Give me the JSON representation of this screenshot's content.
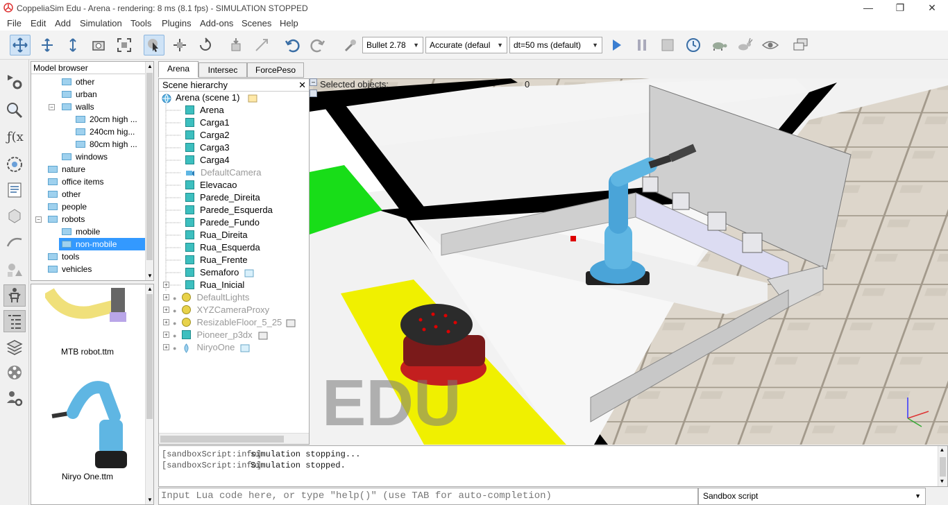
{
  "window": {
    "title": "CoppeliaSim Edu - Arena - rendering: 8 ms (8.1 fps) - SIMULATION STOPPED"
  },
  "menu": [
    "File",
    "Edit",
    "Add",
    "Simulation",
    "Tools",
    "Plugins",
    "Add-ons",
    "Scenes",
    "Help"
  ],
  "toolbar": {
    "engine": "Bullet 2.78",
    "accuracy": "Accurate (defaul",
    "timestep": "dt=50 ms (default)"
  },
  "model_browser": {
    "title": "Model browser",
    "items": [
      {
        "label": "other",
        "level": 2
      },
      {
        "label": "urban",
        "level": 2
      },
      {
        "label": "walls",
        "level": 2,
        "expanded": true
      },
      {
        "label": "20cm high ...",
        "level": 3
      },
      {
        "label": "240cm hig...",
        "level": 3
      },
      {
        "label": "80cm high ...",
        "level": 3
      },
      {
        "label": "windows",
        "level": 2
      },
      {
        "label": "nature",
        "level": 1
      },
      {
        "label": "office items",
        "level": 1
      },
      {
        "label": "other",
        "level": 1
      },
      {
        "label": "people",
        "level": 1
      },
      {
        "label": "robots",
        "level": 1,
        "expanded": true
      },
      {
        "label": "mobile",
        "level": 2
      },
      {
        "label": "non-mobile",
        "level": 2,
        "selected": true
      },
      {
        "label": "tools",
        "level": 1
      },
      {
        "label": "vehicles",
        "level": 1
      }
    ],
    "thumbnails": [
      "MTB robot.ttm",
      "Niryo One.ttm"
    ]
  },
  "tabs": [
    "Arena",
    "Intersec",
    "ForcePeso"
  ],
  "hierarchy": {
    "title": "Scene hierarchy",
    "root": "Arena (scene 1)",
    "items": [
      {
        "label": "Arena"
      },
      {
        "label": "Carga1"
      },
      {
        "label": "Carga2"
      },
      {
        "label": "Carga3"
      },
      {
        "label": "Carga4"
      },
      {
        "label": "DefaultCamera",
        "dim": true
      },
      {
        "label": "Elevacao"
      },
      {
        "label": "Parede_Direita"
      },
      {
        "label": "Parede_Esquerda"
      },
      {
        "label": "Parede_Fundo"
      },
      {
        "label": "Rua_Direita"
      },
      {
        "label": "Rua_Esquerda"
      },
      {
        "label": "Rua_Frente"
      },
      {
        "label": "Semaforo"
      },
      {
        "label": "Rua_Inicial"
      },
      {
        "label": "DefaultLights",
        "dim": true
      },
      {
        "label": "XYZCameraProxy",
        "dim": true
      },
      {
        "label": "ResizableFloor_5_25",
        "dim": true
      },
      {
        "label": "Pioneer_p3dx",
        "dim": true
      },
      {
        "label": "NiryoOne",
        "dim": true
      }
    ]
  },
  "viewport": {
    "selected_label": "Selected objects:",
    "selected_count": "0",
    "watermark": "EDU"
  },
  "console": {
    "lines": [
      {
        "src": "[sandboxScript:info]",
        "msg": "simulation stopping..."
      },
      {
        "src": "[sandboxScript:info]",
        "msg": "Simulation stopped."
      }
    ],
    "input_placeholder": "Input Lua code here, or type \"help()\" (use TAB for auto-completion)",
    "script_select": "Sandbox script"
  },
  "colors": {
    "accent": "#3399ff",
    "folder": "#9fd1ee",
    "selected_row": "#3399ff"
  }
}
